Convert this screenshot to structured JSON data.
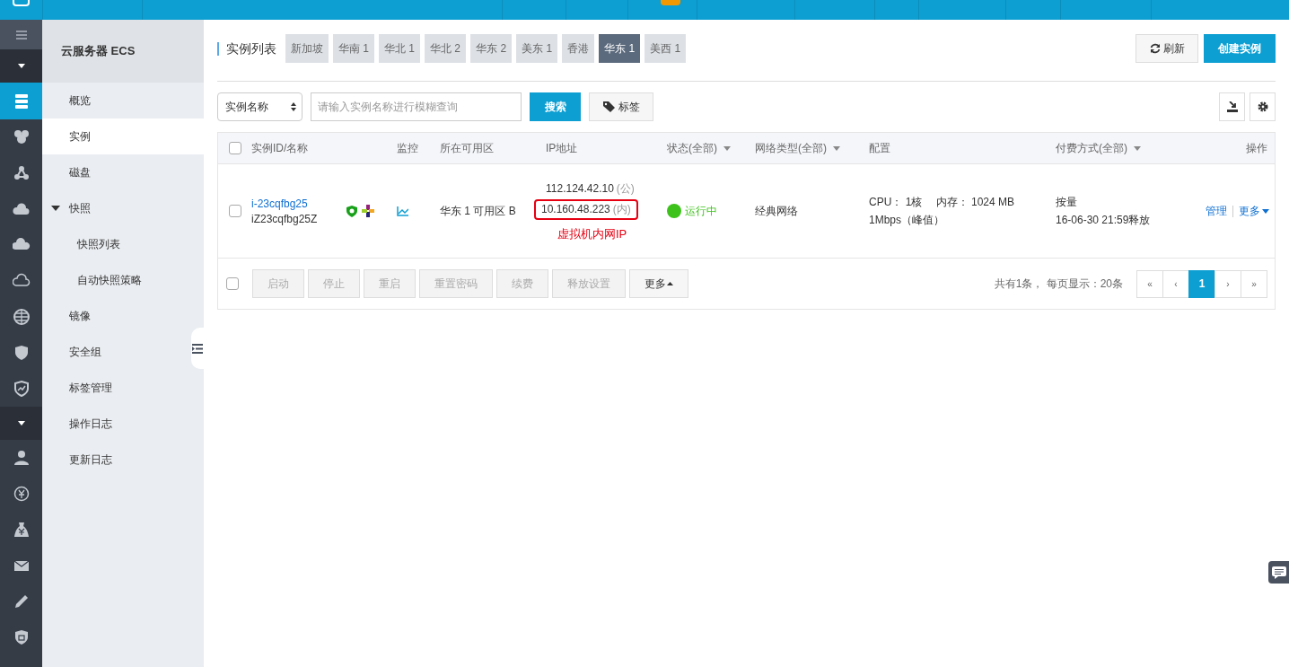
{
  "top_bar": {
    "badge": true
  },
  "rail": [
    {
      "kind": "menu"
    },
    {
      "kind": "toggle"
    },
    {
      "kind": "icon",
      "selected": true
    },
    {
      "kind": "icon",
      "selected": false
    },
    {
      "kind": "icon",
      "selected": false
    },
    {
      "kind": "icon",
      "selected": false
    },
    {
      "kind": "icon",
      "selected": false
    },
    {
      "kind": "icon",
      "selected": false
    },
    {
      "kind": "icon",
      "selected": false
    },
    {
      "kind": "icon",
      "selected": false
    },
    {
      "kind": "icon",
      "selected": false
    },
    {
      "kind": "toggle"
    },
    {
      "kind": "icon",
      "selected": false
    },
    {
      "kind": "icon",
      "selected": false
    },
    {
      "kind": "icon",
      "selected": false
    },
    {
      "kind": "icon",
      "selected": false
    },
    {
      "kind": "icon",
      "selected": false
    },
    {
      "kind": "icon",
      "selected": false
    }
  ],
  "sidebar": {
    "title": "云服务器 ECS",
    "items": [
      {
        "label": "概览",
        "selected": false
      },
      {
        "label": "实例",
        "selected": true
      },
      {
        "label": "磁盘",
        "selected": false
      },
      {
        "label": "快照",
        "selected": false,
        "expanded": true,
        "children": [
          {
            "label": "快照列表",
            "selected": false
          },
          {
            "label": "自动快照策略",
            "selected": false
          }
        ]
      },
      {
        "label": "镜像",
        "selected": false
      },
      {
        "label": "安全组",
        "selected": false
      },
      {
        "label": "标签管理",
        "selected": false
      },
      {
        "label": "操作日志",
        "selected": false
      },
      {
        "label": "更新日志",
        "selected": false
      }
    ]
  },
  "page_title": "实例列表",
  "region_tabs": [
    {
      "label": "新加坡",
      "selected": false
    },
    {
      "label": "华南 1",
      "selected": false
    },
    {
      "label": "华北 1",
      "selected": false
    },
    {
      "label": "华北 2",
      "selected": false
    },
    {
      "label": "华东 2",
      "selected": false
    },
    {
      "label": "美东 1",
      "selected": false
    },
    {
      "label": "香港",
      "selected": false
    },
    {
      "label": "华东 1",
      "selected": true
    },
    {
      "label": "美西 1",
      "selected": false
    }
  ],
  "refresh_button": "刷新",
  "create_button": "创建实例",
  "search": {
    "select": "实例名称",
    "placeholder": "请输入实例名称进行模糊查询",
    "button": "搜索",
    "tag_button": "标签"
  },
  "table": {
    "header_checked": false,
    "columns": [
      {
        "label": "实例ID/名称",
        "filter": false
      },
      {
        "label": "监控",
        "filter": false
      },
      {
        "label": "所在可用区",
        "filter": false
      },
      {
        "label": "IP地址",
        "filter": false
      },
      {
        "label": "状态(全部)",
        "filter": true
      },
      {
        "label": "网络类型(全部)",
        "filter": true
      },
      {
        "label": "配置",
        "filter": false
      },
      {
        "label": "付费方式(全部)",
        "filter": true
      },
      {
        "label": "操作",
        "filter": false
      }
    ],
    "rows": [
      {
        "checked": false,
        "id": "i-23cqfbg25",
        "name": "iZ23cqfbg25Z",
        "zone": "华东 1 可用区 B",
        "ips": [
          {
            "address": "112.124.42.10",
            "suffix": "(公)",
            "highlighted": false
          },
          {
            "address": "10.160.48.223",
            "suffix": "(内)",
            "highlighted": true
          }
        ],
        "note": "虚拟机内网IP",
        "status": {
          "label": "运行中",
          "color": "#3dc21b"
        },
        "network": "经典网络",
        "config": [
          "CPU： 1核　 内存： 1024 MB",
          "1Mbps（峰值）"
        ],
        "payment": [
          "按量",
          "16-06-30 21:59释放"
        ],
        "actions": [
          "管理",
          "更多"
        ]
      }
    ],
    "footer": {
      "checked": false,
      "buttons": [
        {
          "label": "启动",
          "disabled": true
        },
        {
          "label": "停止",
          "disabled": true
        },
        {
          "label": "重启",
          "disabled": true
        },
        {
          "label": "重置密码",
          "disabled": true
        },
        {
          "label": "续费",
          "disabled": true
        },
        {
          "label": "释放设置",
          "disabled": true
        },
        {
          "label": "更多",
          "disabled": false
        }
      ],
      "summary": "共有1条， 每页显示：20条",
      "pages": [
        {
          "label": "«",
          "selected": false
        },
        {
          "label": "‹",
          "selected": false
        },
        {
          "label": "1",
          "selected": true
        },
        {
          "label": "›",
          "selected": false
        },
        {
          "label": "»",
          "selected": false
        }
      ]
    }
  }
}
